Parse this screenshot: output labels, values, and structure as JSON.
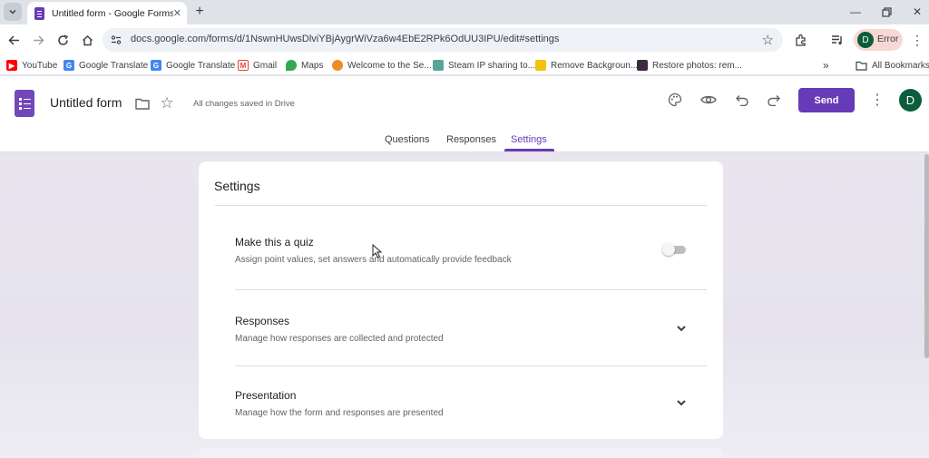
{
  "browser": {
    "tab_title": "Untitled form - Google Forms",
    "url": "docs.google.com/forms/d/1NswnHUwsDlviYBjAygrWiVza6w4EbE2RPk6OdUU3IPU/edit#settings",
    "profile_status": "Error",
    "profile_initial": "D",
    "bookmarks": [
      {
        "label": "YouTube",
        "icon": "youtube-icon"
      },
      {
        "label": "Google Translate",
        "icon": "translate-icon"
      },
      {
        "label": "Google Translate",
        "icon": "translate-icon"
      },
      {
        "label": "Gmail",
        "icon": "gmail-icon"
      },
      {
        "label": "Maps",
        "icon": "maps-icon"
      },
      {
        "label": "Welcome to the Se...",
        "icon": "site-icon"
      },
      {
        "label": "Steam IP sharing to...",
        "icon": "steam-icon"
      },
      {
        "label": "Remove Backgroun...",
        "icon": "remove-bg-icon"
      },
      {
        "label": "Restore photos: rem...",
        "icon": "restore-icon"
      }
    ],
    "all_bookmarks": "All Bookmarks"
  },
  "forms": {
    "title": "Untitled form",
    "save_status": "All changes saved in Drive",
    "send_label": "Send",
    "user_initial": "D",
    "tabs": {
      "questions": "Questions",
      "responses": "Responses",
      "settings": "Settings"
    },
    "active_tab": "Settings",
    "accent_color": "#673ab7"
  },
  "settings": {
    "heading": "Settings",
    "quiz": {
      "title": "Make this a quiz",
      "description": "Assign point values, set answers and automatically provide feedback",
      "enabled": false
    },
    "responses": {
      "title": "Responses",
      "description": "Manage how responses are collected and protected"
    },
    "presentation": {
      "title": "Presentation",
      "description": "Manage how the form and responses are presented"
    }
  }
}
